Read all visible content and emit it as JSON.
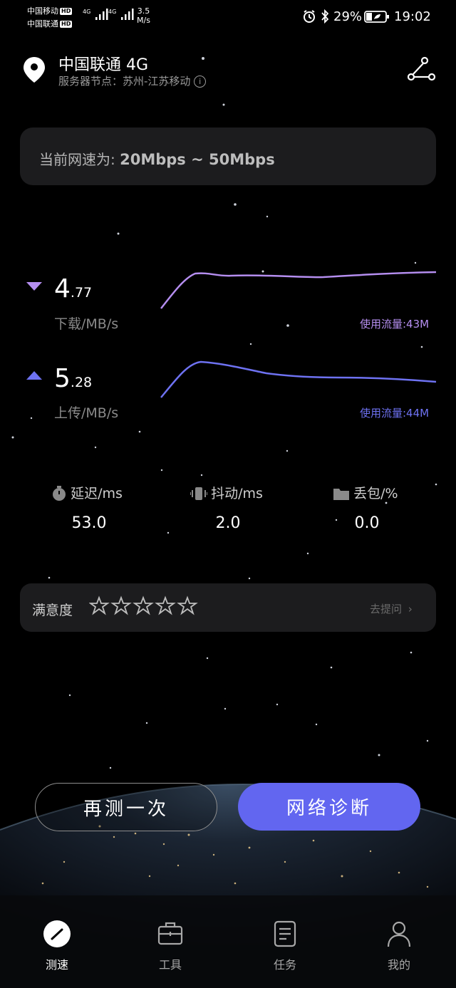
{
  "status_bar": {
    "carrier1": "中国移动",
    "carrier2": "中国联通",
    "hd": "HD",
    "net1": "4G",
    "net2": "4G",
    "speed_value": "3.5",
    "speed_unit": "M/s",
    "battery": "29%",
    "time": "19:02"
  },
  "header": {
    "title": "中国联通 4G",
    "server": "服务器节点：苏州-江苏移动"
  },
  "current_speed": {
    "label": "当前网速为:",
    "value": "20Mbps ~ 50Mbps"
  },
  "download": {
    "int": "4",
    "dec": ".77",
    "unit": "下载/MB/s",
    "usage": "使用流量:43M",
    "color": "#b58ef0"
  },
  "upload": {
    "int": "5",
    "dec": ".28",
    "unit": "上传/MB/s",
    "usage": "使用流量:44M",
    "color": "#6e72f2"
  },
  "stats": {
    "latency_label": "延迟/ms",
    "latency_value": "53.0",
    "jitter_label": "抖动/ms",
    "jitter_value": "2.0",
    "loss_label": "丢包/%",
    "loss_value": "0.0"
  },
  "satisfaction": {
    "label": "满意度",
    "stars": 5,
    "link": "去提问"
  },
  "buttons": {
    "retest": "再测一次",
    "diagnose": "网络诊断"
  },
  "nav": {
    "items": [
      "测速",
      "工具",
      "任务",
      "我的"
    ],
    "active": "测速"
  },
  "colors": {
    "accent": "#6266f0",
    "download_line": "#b58ef0",
    "upload_line": "#6e72f2"
  }
}
